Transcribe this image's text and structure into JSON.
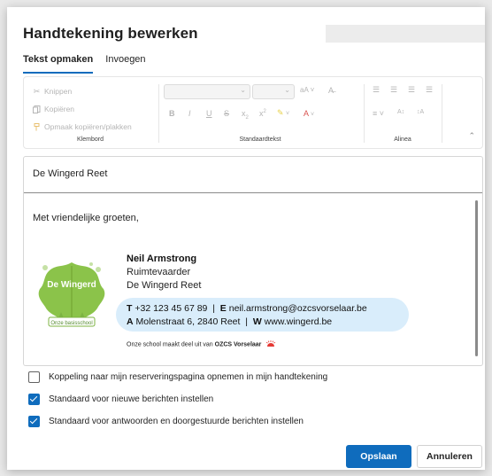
{
  "dialog": {
    "title": "Handtekening bewerken"
  },
  "tabs": [
    {
      "label": "Tekst opmaken",
      "active": true
    },
    {
      "label": "Invoegen",
      "active": false
    }
  ],
  "ribbon": {
    "clipboard": {
      "label": "Klembord",
      "items": [
        {
          "label": "Knippen",
          "icon": "scissors-icon"
        },
        {
          "label": "Kopiëren",
          "icon": "copy-icon"
        },
        {
          "label": "Opmaak kopiëren/plakken",
          "icon": "format-painter-icon"
        }
      ]
    },
    "basic_text": {
      "label": "Standaardtekst"
    },
    "paragraph": {
      "label": "Alinea"
    }
  },
  "signature": {
    "name_field": "De Wingerd Reet",
    "greeting": "Met vriendelijke groeten,",
    "person_name": "Neil Armstrong",
    "person_role": "Ruimtevaarder",
    "organization": "De Wingerd Reet",
    "phone_label": "T",
    "phone": "+32 123 45 67 89",
    "email_label": "E",
    "email": "neil.armstrong@ozcsvorselaar.be",
    "address_label": "A",
    "address": "Molenstraat 6, 2840 Reet",
    "web_label": "W",
    "web": "www.wingerd.be",
    "footnote_prefix": "Onze school maakt deel uit van",
    "footnote_org": "OZCS Vorselaar",
    "logo_text": "De Wingerd",
    "logo_banner": "Onze basisschool"
  },
  "options": [
    {
      "label": "Koppeling naar mijn reserveringspagina opnemen in mijn handtekening",
      "checked": false
    },
    {
      "label": "Standaard voor nieuwe berichten instellen",
      "checked": true
    },
    {
      "label": "Standaard voor antwoorden en doorgestuurde berichten instellen",
      "checked": true
    }
  ],
  "buttons": {
    "save": "Opslaan",
    "cancel": "Annuleren"
  },
  "colors": {
    "accent": "#0f6cbd",
    "contact_bg": "#d9edfb",
    "logo_green": "#7cb342"
  }
}
